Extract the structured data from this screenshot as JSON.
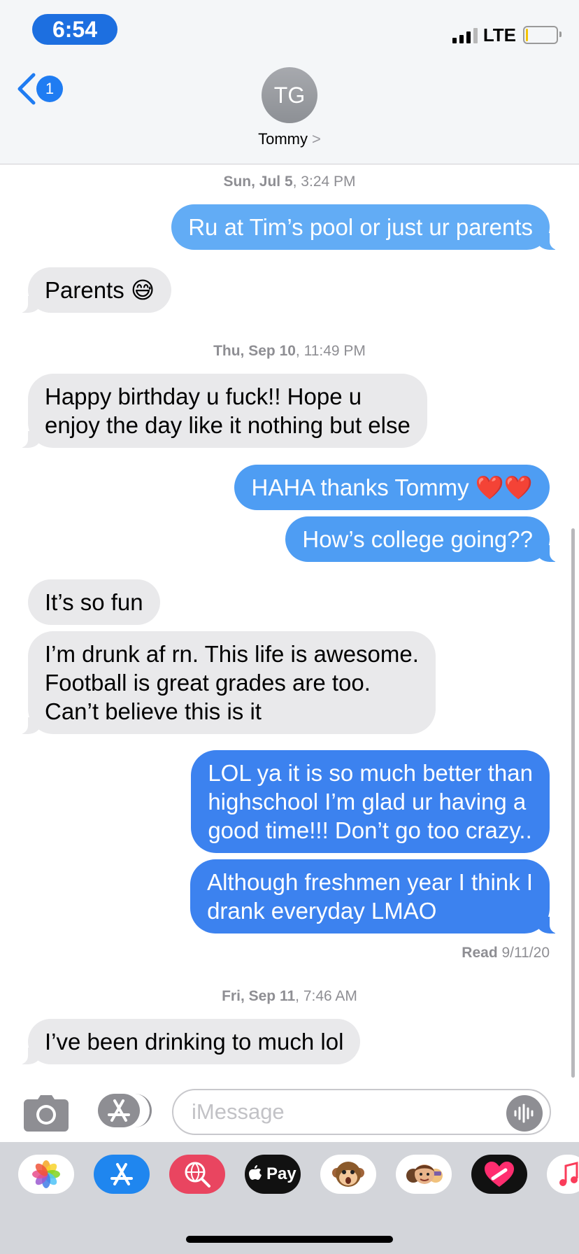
{
  "status_bar": {
    "time": "6:54",
    "network": "LTE"
  },
  "header": {
    "back_badge": "1",
    "avatar_initials": "TG",
    "contact_name": "Tommy",
    "contact_chevron": ">"
  },
  "timestamps": [
    {
      "day": "Sun, Jul 5",
      "time": ", 3:24 PM"
    },
    {
      "day": "Thu, Sep 10",
      "time": ", 11:49 PM"
    },
    {
      "day": "Fri, Sep 11",
      "time": ", 7:46 AM"
    }
  ],
  "messages": [
    {
      "from": "me",
      "lines": [
        "Ru at Tim’s pool or just ur parents"
      ]
    },
    {
      "from": "them",
      "lines": [
        "Parents 😅"
      ]
    },
    {
      "from": "them",
      "lines": [
        "Happy birthday u fuck!! Hope u",
        "enjoy the day like it nothing but else"
      ]
    },
    {
      "from": "me",
      "lines": [
        "HAHA thanks Tommy ❤️❤️"
      ]
    },
    {
      "from": "me",
      "lines": [
        "How’s college going??"
      ]
    },
    {
      "from": "them",
      "lines": [
        "It’s so fun"
      ]
    },
    {
      "from": "them",
      "lines": [
        "I’m drunk af rn. This life is awesome.",
        "Football is great grades are too.",
        "Can’t believe this is it"
      ]
    },
    {
      "from": "me",
      "lines": [
        "LOL ya it is so much better than",
        "highschool I’m glad ur having a",
        "good time!!! Don’t go too crazy.."
      ]
    },
    {
      "from": "me",
      "lines": [
        "Although freshmen year I think I",
        "drank everyday LMAO"
      ]
    },
    {
      "from": "them",
      "lines": [
        "I’ve been drinking to much lol"
      ]
    }
  ],
  "read_receipt": {
    "label": "Read",
    "date": " 9/11/20"
  },
  "composer": {
    "placeholder": "iMessage"
  },
  "app_drawer": {
    "items": [
      "photos-app-icon",
      "app-store-icon",
      "web-search-icon",
      "apple-pay-icon",
      "animoji-icon",
      "memoji-icon",
      "digital-touch-icon",
      "music-icon"
    ],
    "apple_pay_label": " Pay"
  },
  "colors": {
    "sent_light": "#62acf5",
    "sent_dark": "#3c82ef",
    "received": "#e9e9eb",
    "accent": "#1f7cf2"
  }
}
